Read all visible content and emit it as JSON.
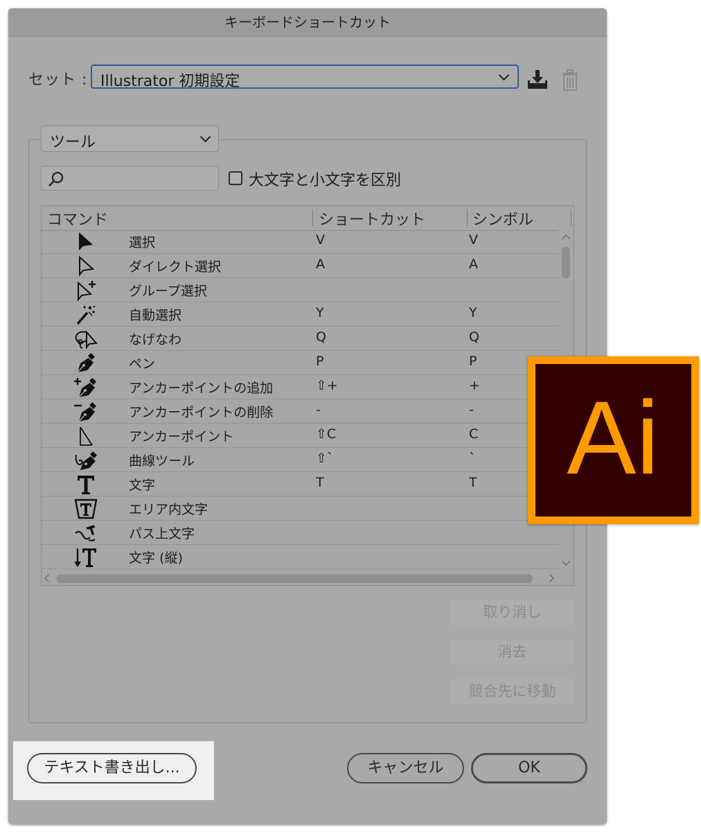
{
  "dialog": {
    "title": "キーボードショートカット"
  },
  "set": {
    "label": "セット :",
    "value": "Illustrator 初期設定"
  },
  "category": {
    "value": "ツール"
  },
  "search": {
    "placeholder": ""
  },
  "case_sensitive": {
    "label": "大文字と小文字を区別",
    "checked": false
  },
  "table": {
    "headers": [
      "コマンド",
      "ショートカット",
      "シンボル"
    ],
    "rows": [
      {
        "icon": "selection-arrow-icon",
        "command": "選択",
        "shortcut": "V",
        "symbol": "V"
      },
      {
        "icon": "direct-selection-icon",
        "command": "ダイレクト選択",
        "shortcut": "A",
        "symbol": "A"
      },
      {
        "icon": "group-selection-icon",
        "command": "グループ選択",
        "shortcut": "",
        "symbol": ""
      },
      {
        "icon": "magic-wand-icon",
        "command": "自動選択",
        "shortcut": "Y",
        "symbol": "Y"
      },
      {
        "icon": "lasso-icon",
        "command": "なげなわ",
        "shortcut": "Q",
        "symbol": "Q"
      },
      {
        "icon": "pen-icon",
        "command": "ペン",
        "shortcut": "P",
        "symbol": "P"
      },
      {
        "icon": "add-anchor-point-icon",
        "command": "アンカーポイントの追加",
        "shortcut": "⇧+",
        "symbol": "+"
      },
      {
        "icon": "delete-anchor-point-icon",
        "command": "アンカーポイントの削除",
        "shortcut": "-",
        "symbol": "-"
      },
      {
        "icon": "anchor-point-icon",
        "command": "アンカーポイント",
        "shortcut": "⇧C",
        "symbol": "C"
      },
      {
        "icon": "curvature-icon",
        "command": "曲線ツール",
        "shortcut": "⇧`",
        "symbol": "`"
      },
      {
        "icon": "type-icon",
        "command": "文字",
        "shortcut": "T",
        "symbol": "T"
      },
      {
        "icon": "area-type-icon",
        "command": "エリア内文字",
        "shortcut": "",
        "symbol": ""
      },
      {
        "icon": "type-on-path-icon",
        "command": "パス上文字",
        "shortcut": "",
        "symbol": ""
      },
      {
        "icon": "vertical-type-icon",
        "command": "文字 (縦)",
        "shortcut": "",
        "symbol": ""
      }
    ]
  },
  "buttons": {
    "undo": "取り消し",
    "clear": "消去",
    "go_to_conflict": "競合先に移動",
    "export_text": "テキスト書き出し...",
    "cancel": "キャンセル",
    "ok": "OK"
  },
  "logo": {
    "text": "Ai",
    "border_color": "#ff9a00",
    "bg_color": "#330000",
    "text_color": "#ff9a00"
  },
  "colors": {
    "dialog_bg": "#a9a9a9",
    "focus_border": "#2f5d9b"
  }
}
